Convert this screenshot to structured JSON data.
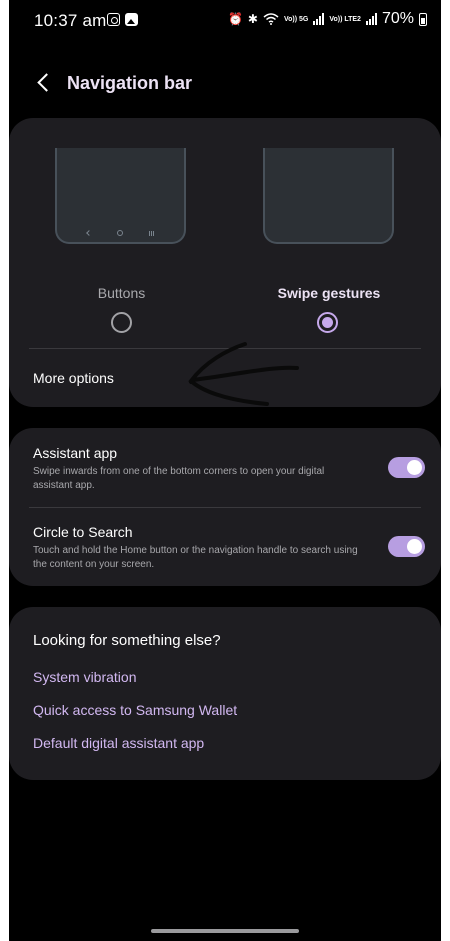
{
  "status_bar": {
    "time": "10:37 am",
    "left_icons": [
      "instagram-icon",
      "gallery-icon"
    ],
    "right_icons": [
      "alarm-icon",
      "bluetooth-icon",
      "wifi-icon",
      "signal-icon",
      "signal-icon"
    ],
    "network_1": "Vo)) 5G",
    "network_2": "Vo)) LTE2",
    "battery": "70%"
  },
  "header": {
    "title": "Navigation bar"
  },
  "nav_type": {
    "options": [
      {
        "label": "Buttons",
        "selected": false
      },
      {
        "label": "Swipe gestures",
        "selected": true
      }
    ],
    "more_options": "More options"
  },
  "toggles": [
    {
      "title": "Assistant app",
      "description": "Swipe inwards from one of the bottom corners to open your digital assistant app.",
      "on": true
    },
    {
      "title": "Circle to Search",
      "description": "Touch and hold the Home button or the navigation handle to search using the content on your screen.",
      "on": true
    }
  ],
  "suggestions": {
    "heading": "Looking for something else?",
    "links": [
      "System vibration",
      "Quick access to Samsung Wallet",
      "Default digital assistant app"
    ]
  },
  "colors": {
    "background": "#000000",
    "card": "#1e1d21",
    "accent": "#c6a9eb",
    "toggle": "#b79ee1",
    "link": "#d2b8f1"
  }
}
